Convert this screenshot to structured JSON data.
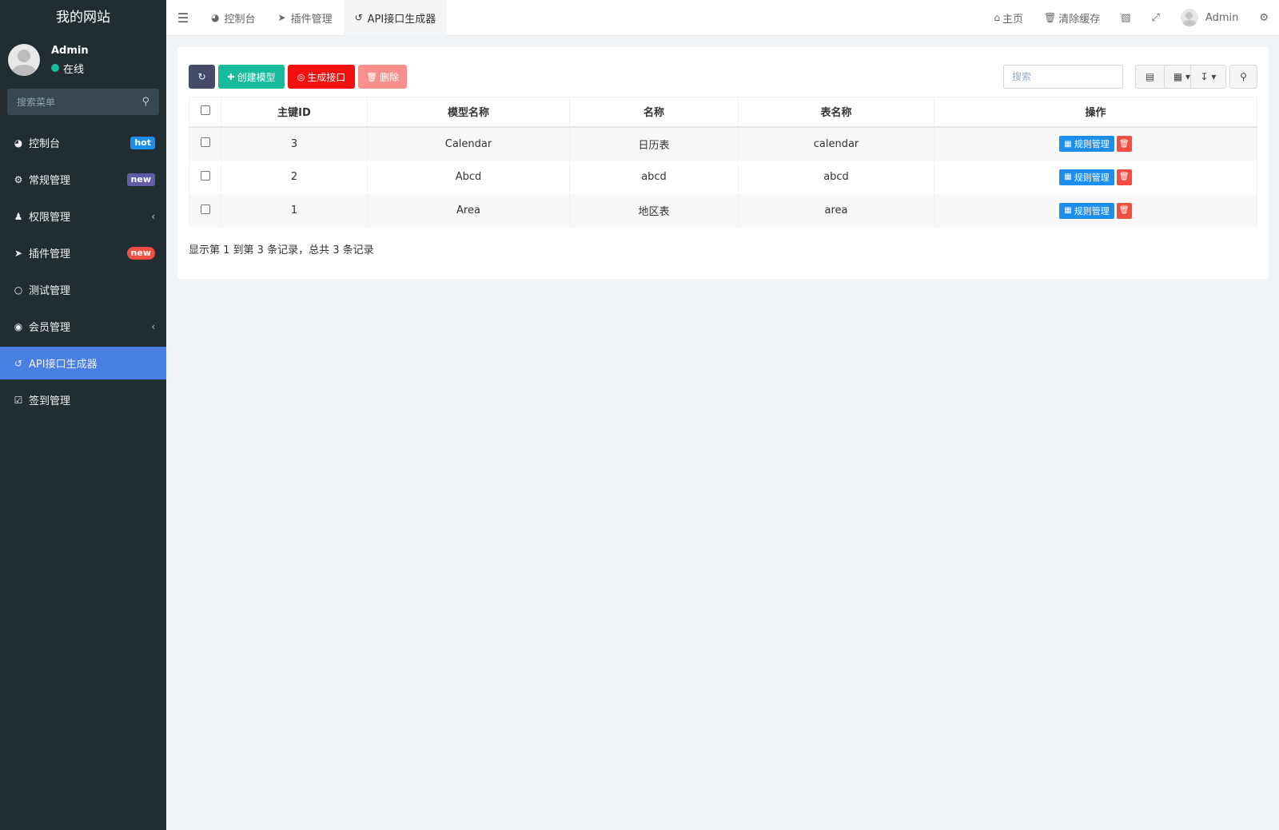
{
  "site": {
    "title": "我的网站"
  },
  "user": {
    "name": "Admin",
    "status": "在线"
  },
  "sidebar": {
    "search_placeholder": "搜索菜单",
    "items": [
      {
        "label": "控制台",
        "icon": "dashboard-icon",
        "badge": "hot"
      },
      {
        "label": "常规管理",
        "icon": "cogs-icon",
        "badge": "new"
      },
      {
        "label": "权限管理",
        "icon": "users-icon",
        "chevron": true
      },
      {
        "label": "插件管理",
        "icon": "rocket-icon",
        "badge": "new"
      },
      {
        "label": "测试管理",
        "icon": "circle-icon"
      },
      {
        "label": "会员管理",
        "icon": "user-circle-icon",
        "chevron": true
      },
      {
        "label": "API接口生成器",
        "icon": "api-icon",
        "active": true
      },
      {
        "label": "签到管理",
        "icon": "calendar-check-icon"
      }
    ]
  },
  "topbar": {
    "tabs": [
      {
        "label": "控制台",
        "icon": "dashboard-icon"
      },
      {
        "label": "插件管理",
        "icon": "rocket-icon"
      },
      {
        "label": "API接口生成器",
        "icon": "api-icon",
        "active": true
      }
    ],
    "home_label": "主页",
    "clear_cache_label": "清除缓存",
    "user_name": "Admin"
  },
  "toolbar": {
    "create_label": "创建模型",
    "generate_label": "生成接口",
    "delete_label": "删除",
    "search_placeholder": "搜索"
  },
  "table": {
    "columns": [
      "主键ID",
      "模型名称",
      "名称",
      "表名称",
      "操作"
    ],
    "rows": [
      {
        "id": "3",
        "model": "Calendar",
        "name": "日历表",
        "table": "calendar"
      },
      {
        "id": "2",
        "model": "Abcd",
        "name": "abcd",
        "table": "abcd"
      },
      {
        "id": "1",
        "model": "Area",
        "name": "地区表",
        "table": "area"
      }
    ],
    "manage_label": "规则管理"
  },
  "pagination": {
    "info": "显示第 1 到第 3 条记录，总共 3 条记录"
  },
  "colors": {
    "sidebar_bg": "#222d32",
    "active_menu": "#4a7fe3",
    "create_btn": "#18bc9c",
    "generate_btn": "#f30f0f",
    "delete_btn": "#f7908b",
    "manage_btn": "#1c8ef0"
  }
}
